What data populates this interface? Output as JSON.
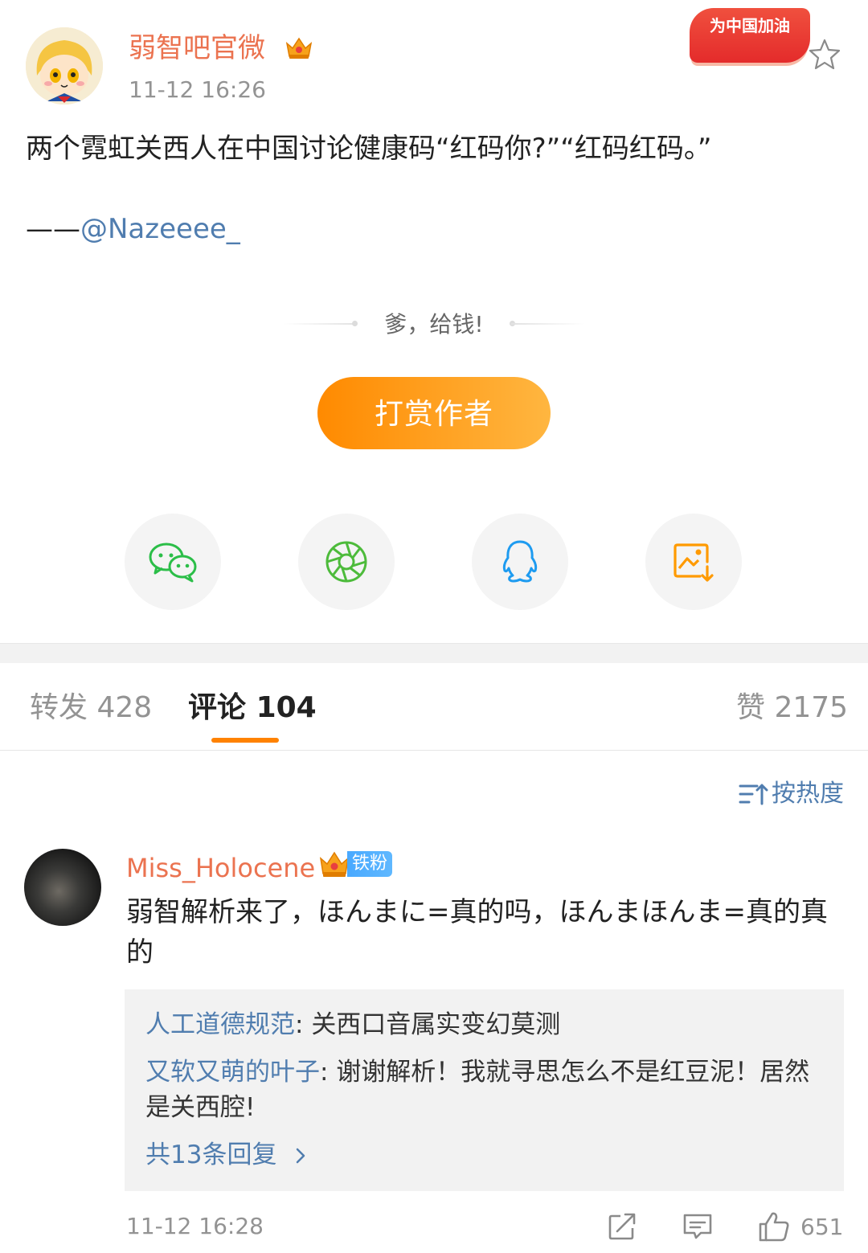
{
  "post": {
    "author": "弱智吧官微",
    "time": "11-12 16:26",
    "promo_badge": "为中国加油",
    "text": "两个霓虹关西人在中国讨论健康码“红码你?”“红码红码。”",
    "credit_prefix": "——",
    "credit_mention": "@Nazeeee_"
  },
  "reward": {
    "tip": "爹，给钱!",
    "button": "打赏作者"
  },
  "share": {
    "icons": [
      "wechat-icon",
      "moments-icon",
      "qq-icon",
      "save-image-icon"
    ]
  },
  "tabs": {
    "repost_label": "转发",
    "repost_count": "428",
    "comment_label": "评论",
    "comment_count": "104",
    "like_label": "赞",
    "like_count": "2175"
  },
  "sort": {
    "label": "按热度"
  },
  "comment": {
    "user": "Miss_Holocene",
    "badge": "铁粉",
    "text": "弱智解析来了，ほんまに=真的吗，ほんまほんま=真的真的",
    "time": "11-12 16:28",
    "like_count": "651",
    "replies": [
      {
        "user": "人工道德规范",
        "sep": ": ",
        "text": "关西口音属实变幻莫测"
      },
      {
        "user": "又软又萌的叶子",
        "sep": ": ",
        "text": "谢谢解析！我就寻思怎么不是红豆泥！居然是关西腔!"
      }
    ],
    "more_replies": "共13条回复"
  },
  "colors": {
    "accent_orange": "#ff8200",
    "name_orange": "#eb7350",
    "link_blue": "#507daf",
    "muted_gray": "#939393"
  }
}
